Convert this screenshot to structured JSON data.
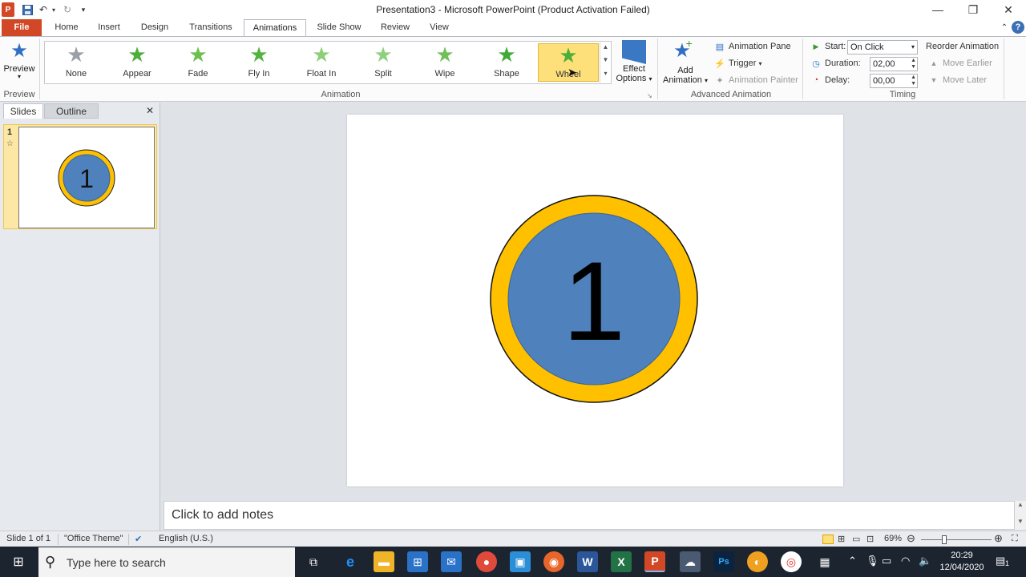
{
  "window": {
    "title": "Presentation3 - Microsoft PowerPoint (Product Activation Failed)",
    "minimize_icon": "minimize-icon",
    "restore_icon": "restore-icon",
    "close_icon": "close-icon"
  },
  "tabs": [
    {
      "label": "File"
    },
    {
      "label": "Home"
    },
    {
      "label": "Insert"
    },
    {
      "label": "Design"
    },
    {
      "label": "Transitions"
    },
    {
      "label": "Animations"
    },
    {
      "label": "Slide Show"
    },
    {
      "label": "Review"
    },
    {
      "label": "View"
    }
  ],
  "ribbon": {
    "preview": {
      "label": "Preview",
      "group": "Preview"
    },
    "animation_group": "Animation",
    "animations": [
      {
        "label": "None",
        "color": "#9aa0a6"
      },
      {
        "label": "Appear",
        "color": "#4caf3a"
      },
      {
        "label": "Fade",
        "color": "#6cc050"
      },
      {
        "label": "Fly In",
        "color": "#52b440"
      },
      {
        "label": "Float In",
        "color": "#8ccf78"
      },
      {
        "label": "Split",
        "color": "#8fd080"
      },
      {
        "label": "Wipe",
        "color": "#70c05a"
      },
      {
        "label": "Shape",
        "color": "#3faa35"
      },
      {
        "label": "Wheel",
        "color": "#4caf3a"
      }
    ],
    "effect_options": {
      "line1": "Effect",
      "line2": "Options"
    },
    "advanced": {
      "group": "Advanced Animation",
      "add_line1": "Add",
      "add_line2": "Animation",
      "pane": "Animation Pane",
      "trigger": "Trigger",
      "painter": "Animation Painter"
    },
    "timing": {
      "group": "Timing",
      "start_label": "Start:",
      "start_value": "On Click",
      "duration_label": "Duration:",
      "duration_value": "02,00",
      "delay_label": "Delay:",
      "delay_value": "00,00",
      "reorder": "Reorder Animation",
      "move_earlier": "Move Earlier",
      "move_later": "Move Later"
    }
  },
  "left_pane": {
    "tab_slides": "Slides",
    "tab_outline": "Outline",
    "slide_number": "1",
    "thumb_text": "1"
  },
  "slide": {
    "number_text": "1",
    "ring_color": "#ffc000",
    "fill_color": "#4f81bd"
  },
  "notes": {
    "placeholder": "Click to add notes"
  },
  "status": {
    "slide_info": "Slide 1 of 1",
    "theme": "\"Office Theme\"",
    "language": "English (U.S.)",
    "zoom": "69%"
  },
  "taskbar": {
    "search_placeholder": "Type here to search",
    "time": "20:29",
    "date": "12/04/2020",
    "notification_count": "1"
  }
}
